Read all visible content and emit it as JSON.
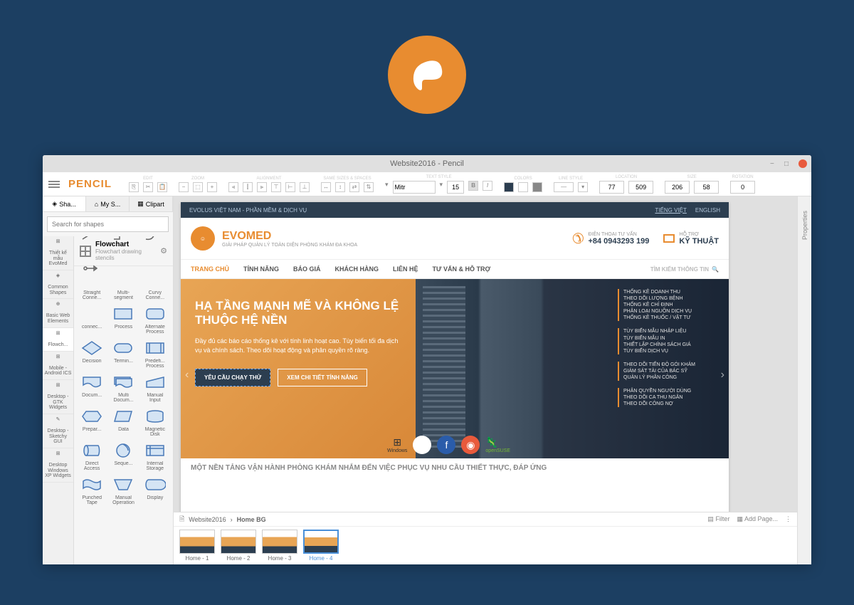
{
  "window_title": "Website2016 - Pencil",
  "brand": "PENCIL",
  "toolbar": {
    "groups": [
      "EDIT",
      "ZOOM",
      "ALIGNMENT",
      "SAME SIZES & SPACES",
      "TEXT STYLE",
      "COLORS",
      "LINE STYLE",
      "LOCATION",
      "SIZE",
      "ROTATION"
    ],
    "font": "Mitr",
    "font_size": "15",
    "bold": "B",
    "italic": "I",
    "loc_x": "77",
    "loc_y": "509",
    "size_w": "206",
    "size_h": "58",
    "rotation": "0"
  },
  "side_tabs": {
    "shapes": "Sha...",
    "mystuff": "My S...",
    "clipart": "Clipart"
  },
  "search_placeholder": "Search for shapes",
  "categories": [
    "Thiết kế mẫu EvoMed",
    "Common Shapes",
    "Basic Web Elements",
    "Flowch...",
    "Mobile - Android ICS",
    "Desktop - GTK Widgets",
    "Desktop - Sketchy GUI",
    "Desktop Windows XP Widgets"
  ],
  "stencil": {
    "title": "Flowchart",
    "subtitle": "Flowchart drawing stencils"
  },
  "shapes": [
    "Straight Conne...",
    "Multi-segment",
    "Curvy Conne...",
    "connec...",
    "Process",
    "Alternate Process",
    "Decision",
    "Termin...",
    "Predefi... Process",
    "Docum...",
    "Multi Docum...",
    "Manual Input",
    "Prepar...",
    "Data",
    "Magnetic Disk",
    "Direct Access",
    "Seque...",
    "Internal Storage",
    "Punched Tape",
    "Manual Operation",
    "Display"
  ],
  "mockup": {
    "topbar_left": "EVOLUS VIỆT NAM - PHẦN MỀM & DỊCH VỤ",
    "topbar_lang1": "TIẾNG VIỆT",
    "topbar_lang2": "ENGLISH",
    "brand": "EVOMED",
    "tagline": "GIẢI PHÁP QUẢN LÝ TOÀN DIỆN PHÒNG KHÁM ĐA KHOA",
    "phone_label": "ĐIỆN THOẠI TƯ VẤN",
    "phone": "+84 0943293 199",
    "support_label": "HỖ TRỢ",
    "support": "KỸ THUẬT",
    "nav": [
      "TRANG CHỦ",
      "TÍNH NĂNG",
      "BÁO GIÁ",
      "KHÁCH HÀNG",
      "LIÊN HỆ",
      "TƯ VẤN & HỖ TRỢ"
    ],
    "search_placeholder": "TÌM KIẾM THÔNG TIN",
    "hero_title": "HẠ TẦNG MẠNH MẼ VÀ KHÔNG LỆ THUỘC HỆ NỀN",
    "hero_desc": "Đầy đủ các báo cáo thống kê với tính linh hoạt cao. Tùy biến tối đa dịch vụ và chính sách. Theo dõi hoạt động và phân quyền rõ ràng.",
    "btn1": "YÊU CẦU CHẠY THỬ",
    "btn2": "XEM CHI TIẾT TÍNH NĂNG",
    "os_win": "Windows",
    "os_suse": "openSUSE",
    "features": [
      [
        "THỐNG KÊ DOANH THU",
        "THEO DÕI LƯỢNG BỆNH",
        "THỐNG KÊ CHỈ ĐỊNH",
        "PHÂN LOẠI NGUỒN DỊCH VỤ",
        "THỐNG KÊ THUỐC / VẬT TƯ"
      ],
      [
        "TÙY BIẾN MẪU NHẬP LIỆU",
        "TÙY BIẾN MẪU IN",
        "THIẾT LẬP CHÍNH SÁCH GIÁ",
        "TÙY BIẾN DỊCH VỤ"
      ],
      [
        "THEO DÕI TIẾN ĐỘ GÓI KHÁM",
        "GIÁM SÁT TÀI CỦA BÁC SỸ",
        "QUẢN LÝ PHÂN CÔNG"
      ],
      [
        "PHÂN QUYỀN NGƯỜI DÙNG",
        "THEO DÕI CA THU NGÂN",
        "THEO DÕI CÔNG NỢ"
      ]
    ],
    "sub_heading": "MỘT NỀN TẢNG VẬN HÀNH PHÒNG KHÁM NHẮM ĐẾN VIỆC PHỤC VỤ NHU CẦU THIẾT THỰC, ĐÁP ỨNG"
  },
  "properties_label": "Properties",
  "breadcrumb": {
    "doc": "Website2016",
    "page": "Home BG"
  },
  "footer": {
    "filter": "Filter",
    "add_page": "Add Page..."
  },
  "pages": [
    "Home - 1",
    "Home - 2",
    "Home - 3",
    "Home - 4"
  ]
}
